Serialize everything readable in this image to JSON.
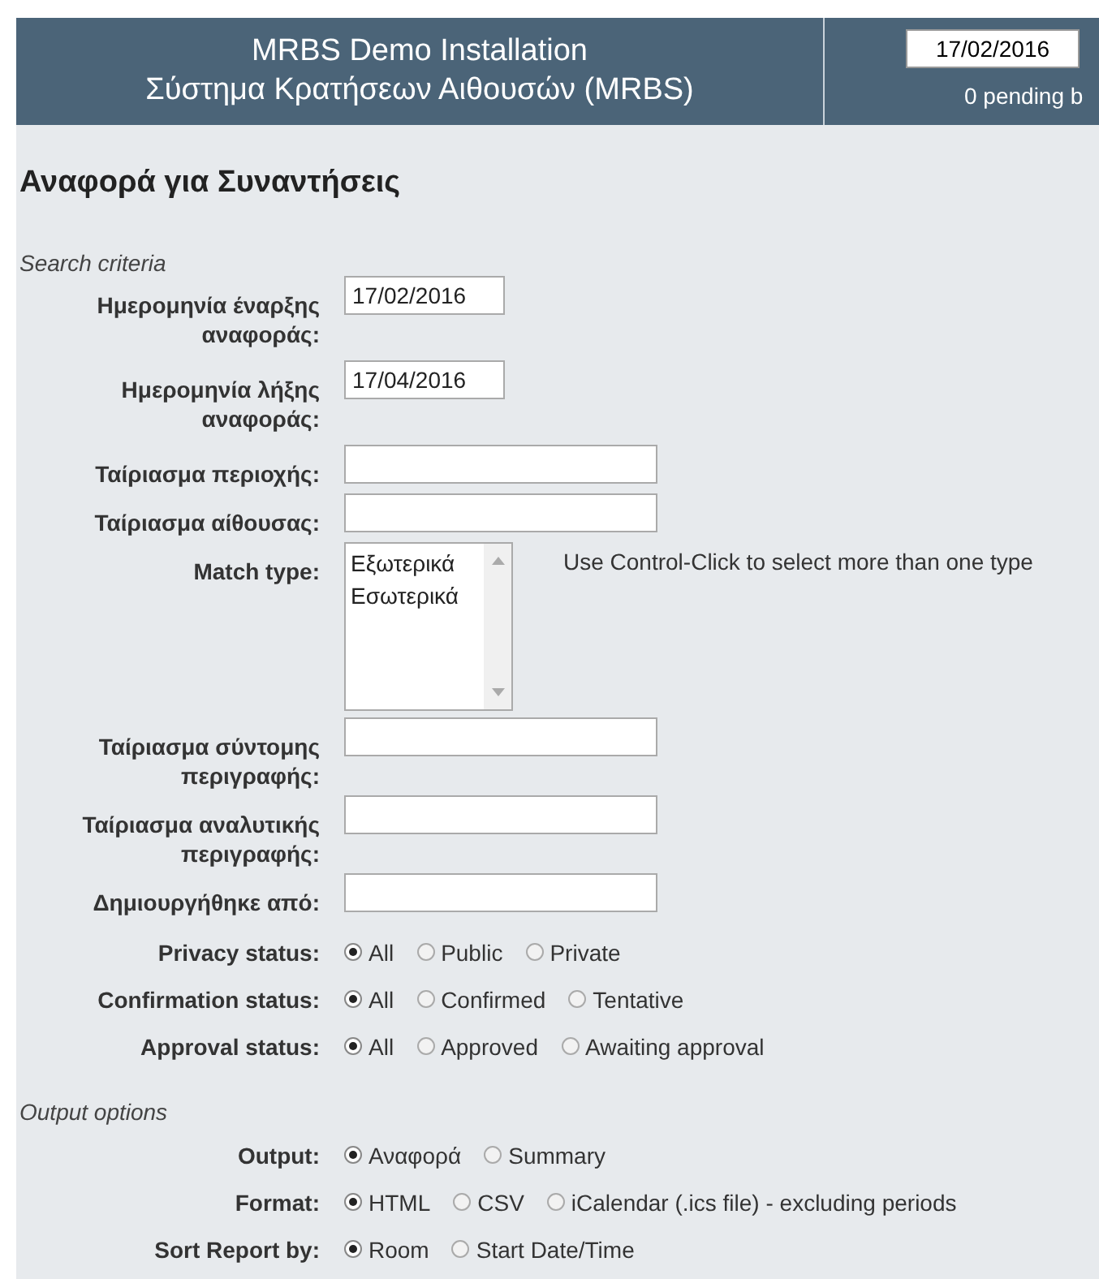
{
  "header": {
    "title": "MRBS Demo Installation",
    "subtitle": "Σύστημα Κρατήσεων Αιθουσών (MRBS)",
    "date_field": {
      "value": "17/02/2016"
    },
    "pending": "0 pending b"
  },
  "page_title": "Αναφορά για Συναντήσεις",
  "sections": [
    {
      "legend": "Search criteria",
      "rows": [
        {
          "kind": "date",
          "label": "Ημερομηνία έναρξης αναφοράς:",
          "value": "17/02/2016"
        },
        {
          "kind": "date",
          "label": "Ημερομηνία λήξης αναφοράς:",
          "value": "17/04/2016"
        },
        {
          "kind": "text",
          "label": "Ταίριασμα περιοχής:"
        },
        {
          "kind": "text",
          "label": "Ταίριασμα αίθουσας:"
        },
        {
          "kind": "select",
          "label": "Match type:",
          "hint": "Use Control-Click to select more than one type",
          "options": [
            {
              "label": "Εξωτερικά",
              "selected": false
            },
            {
              "label": "Εσωτερικά",
              "selected": false
            }
          ]
        },
        {
          "kind": "text",
          "label": "Ταίριασμα σύντομης περιγραφής:"
        },
        {
          "kind": "text",
          "label": "Ταίριασμα αναλυτικής περιγραφής:"
        },
        {
          "kind": "text",
          "label": "Δημιουργήθηκε από:"
        },
        {
          "kind": "radio",
          "label": "Privacy status:",
          "options": [
            {
              "label": "All",
              "selected": true
            },
            {
              "label": "Public",
              "selected": false
            },
            {
              "label": "Private",
              "selected": false
            }
          ]
        },
        {
          "kind": "radio",
          "label": "Confirmation status:",
          "options": [
            {
              "label": "All",
              "selected": true
            },
            {
              "label": "Confirmed",
              "selected": false
            },
            {
              "label": "Tentative",
              "selected": false
            }
          ]
        },
        {
          "kind": "radio",
          "label": "Approval status:",
          "options": [
            {
              "label": "All",
              "selected": true
            },
            {
              "label": "Approved",
              "selected": false
            },
            {
              "label": "Awaiting approval",
              "selected": false
            }
          ]
        }
      ]
    },
    {
      "legend": "Output options",
      "rows": [
        {
          "kind": "radio",
          "label": "Output:",
          "options": [
            {
              "label": "Αναφορά",
              "selected": true
            },
            {
              "label": "Summary",
              "selected": false
            }
          ]
        },
        {
          "kind": "radio",
          "label": "Format:",
          "options": [
            {
              "label": "HTML",
              "selected": true
            },
            {
              "label": "CSV",
              "selected": false
            },
            {
              "label": "iCalendar (.ics file) - excluding periods",
              "selected": false
            }
          ]
        },
        {
          "kind": "radio",
          "label": "Sort Report by:",
          "options": [
            {
              "label": "Room",
              "selected": true
            },
            {
              "label": "Start Date/Time",
              "selected": false
            }
          ]
        }
      ]
    }
  ]
}
